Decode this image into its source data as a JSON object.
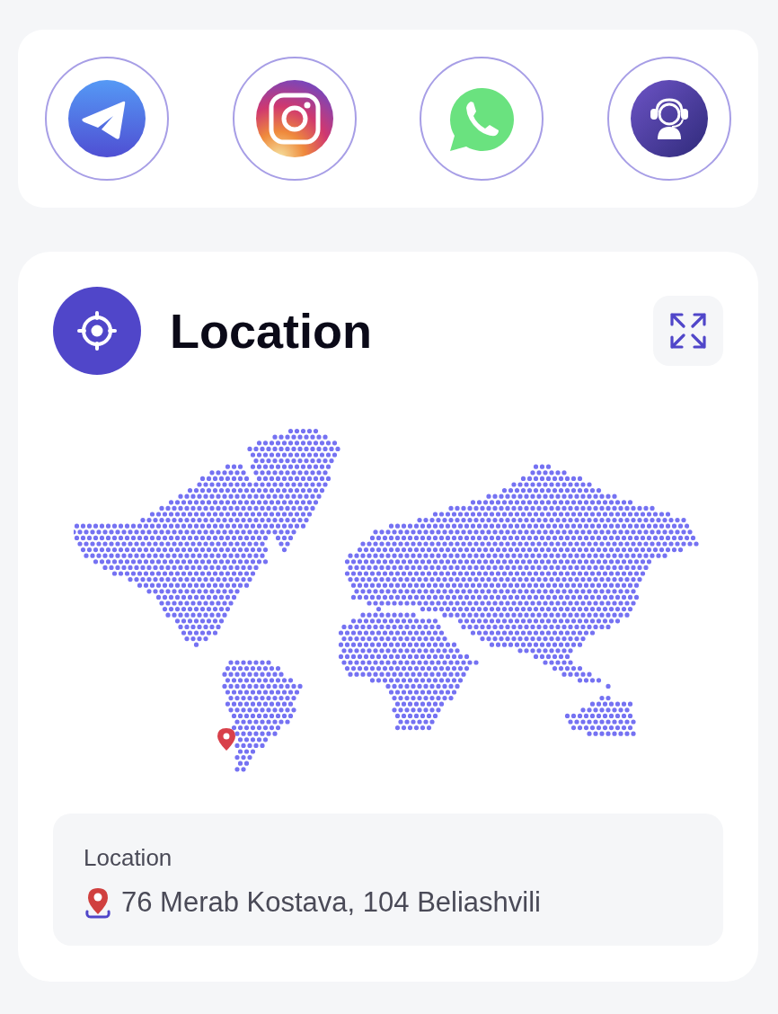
{
  "contacts": [
    {
      "kind": "telegram"
    },
    {
      "kind": "instagram"
    },
    {
      "kind": "whatsapp"
    },
    {
      "kind": "support"
    }
  ],
  "location": {
    "title": "Location",
    "address_label": "Location",
    "address": "76 Merab Kostava, 104 Beliashvili"
  }
}
